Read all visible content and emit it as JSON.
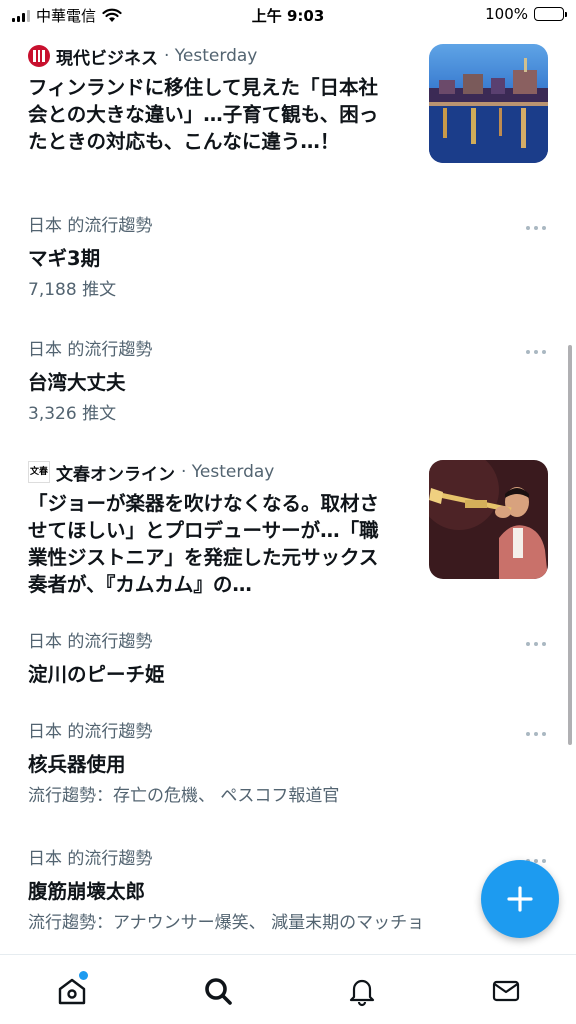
{
  "status_bar": {
    "carrier": "中華電信",
    "time": "上午 9:03",
    "battery": "100%"
  },
  "feed": {
    "news1": {
      "source": "現代ビジネス",
      "time": "· Yesterday",
      "headline": "フィンランドに移住して見えた「日本社会との大きな違い」…子育て観も、困ったときの対応も、こんなに違う…！"
    },
    "trend1": {
      "context": "日本 的流行趨勢",
      "title": "マギ3期",
      "count": "7,188 推文"
    },
    "trend2": {
      "context": "日本 的流行趨勢",
      "title": "台湾大丈夫",
      "count": "3,326 推文"
    },
    "news2": {
      "source": "文春オンライン",
      "time": "· Yesterday",
      "headline": "「ジョーが楽器を吹けなくなる。取材させてほしい」とプロデューサーが…「職業性ジストニア」を発症した元サックス奏者が、『カムカム』の…"
    },
    "trend3": {
      "context": "日本 的流行趨勢",
      "title": "淀川のピーチ姫"
    },
    "trend4": {
      "context": "日本 的流行趨勢",
      "title": "核兵器使用",
      "related": "流行趨勢：存亡の危機、 ペスコフ報道官"
    },
    "trend5": {
      "context": "日本 的流行趨勢",
      "title": "腹筋崩壊太郎",
      "related": "流行趨勢：アナウンサー爆笑、 減量末期のマッチョ"
    }
  },
  "icons": {
    "home": "home-icon",
    "search": "search-icon",
    "notifications": "bell-icon",
    "messages": "mail-icon",
    "compose": "plus-icon",
    "more": "more-icon",
    "wifi": "wifi-icon"
  },
  "colors": {
    "accent": "#1d9bf0",
    "secondary_text": "#536471",
    "primary_text": "#0f1419"
  }
}
